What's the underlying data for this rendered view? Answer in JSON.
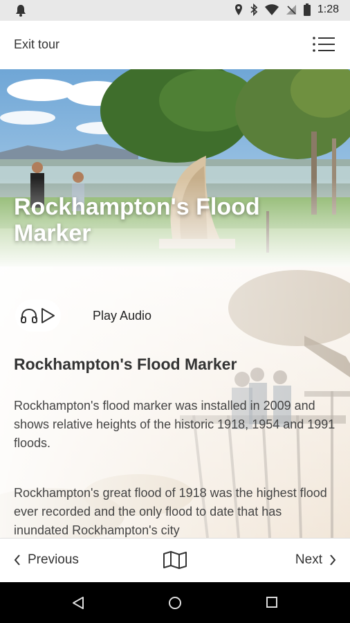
{
  "status": {
    "time": "1:28"
  },
  "topbar": {
    "exit_label": "Exit tour"
  },
  "hero": {
    "title": "Rockhampton's Flood Marker"
  },
  "audio": {
    "label": "Play Audio"
  },
  "article": {
    "heading": "Rockhampton's Flood Marker",
    "paragraph1": "Rockhampton's flood marker was installed in 2009 and shows relative heights of the historic 1918, 1954 and 1991 floods.",
    "paragraph2": "Rockhampton's great flood of 1918 was the highest flood ever recorded and the only flood to date that has inundated Rockhampton's city"
  },
  "bottombar": {
    "previous_label": "Previous",
    "next_label": "Next"
  },
  "colors": {
    "text": "#333333",
    "nav_background": "#000000"
  }
}
